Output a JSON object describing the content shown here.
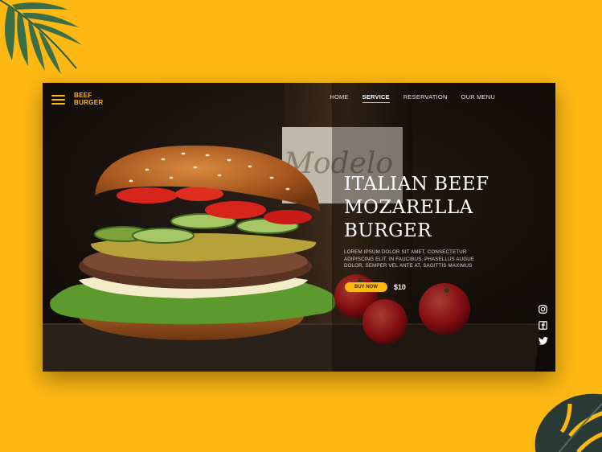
{
  "brand": {
    "line1": "BEEF",
    "line2": "BURGER"
  },
  "nav": {
    "items": [
      {
        "label": "HOME",
        "active": false
      },
      {
        "label": "SERVICE",
        "active": true
      },
      {
        "label": "RESERVATION",
        "active": false
      },
      {
        "label": "OUR MENU",
        "active": false
      }
    ]
  },
  "hero": {
    "title_lines": [
      "ITALIAN BEEF",
      "MOZARELLA",
      "BURGER"
    ],
    "description_lines": [
      "LOREM IPSUM DOLOR SIT AMET, CONSECTETUR",
      "ADIPISCING ELIT. IN FAUCIBUS, PHASELLUS AUGUE",
      "DOLOR, SEMPER VEL ANTE AT, SAGITTIS MAXIMUS"
    ],
    "buy_label": "BUY NOW",
    "price": "$10"
  },
  "bottle_label": "Modelo",
  "social_icons": [
    "instagram-icon",
    "facebook-icon",
    "twitter-icon"
  ],
  "colors": {
    "accent": "#FDB813",
    "frame_bg": "#1e1611",
    "title": "#ffffff"
  }
}
